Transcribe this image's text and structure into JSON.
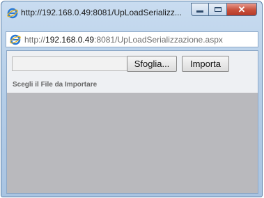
{
  "window": {
    "title": "http://192.168.0.49:8081/UpLoadSerializz...",
    "icon": "ie-icon",
    "controls": [
      "minimize-icon",
      "maximize-icon",
      "close-icon"
    ]
  },
  "address_bar": {
    "prefix": "http://",
    "host": "192.168.0.49",
    "rest": ":8081/UpLoadSerializzazione.aspx"
  },
  "form": {
    "file_value": "",
    "browse_label": "Sfoglia...",
    "import_label": "Importa",
    "caption": "Scegli il File da Importare"
  },
  "colors": {
    "frame": "#b7cfe8",
    "content_bg": "#b9b9bd",
    "close_button": "#c8503b"
  }
}
